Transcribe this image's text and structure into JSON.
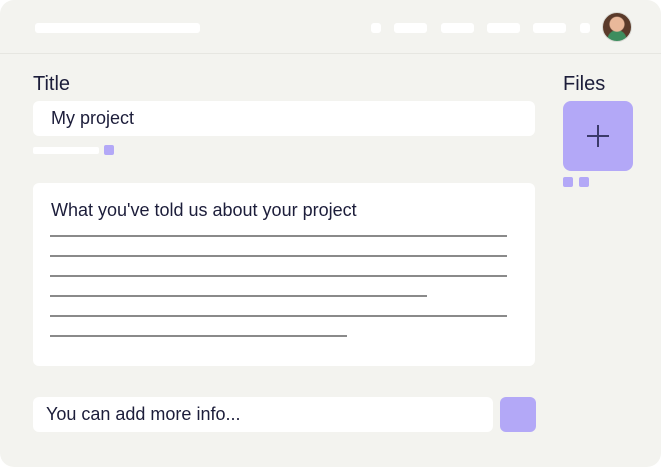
{
  "form": {
    "title_label": "Title",
    "title_value": "My project",
    "files_label": "Files",
    "description_heading": "What you've told us about your project",
    "more_info_placeholder": "You can add more info..."
  },
  "colors": {
    "accent": "#b3a8f7",
    "background": "#f3f3ef",
    "text": "#1c1d3a"
  },
  "icons": {
    "add_file": "plus-icon",
    "user": "avatar"
  }
}
